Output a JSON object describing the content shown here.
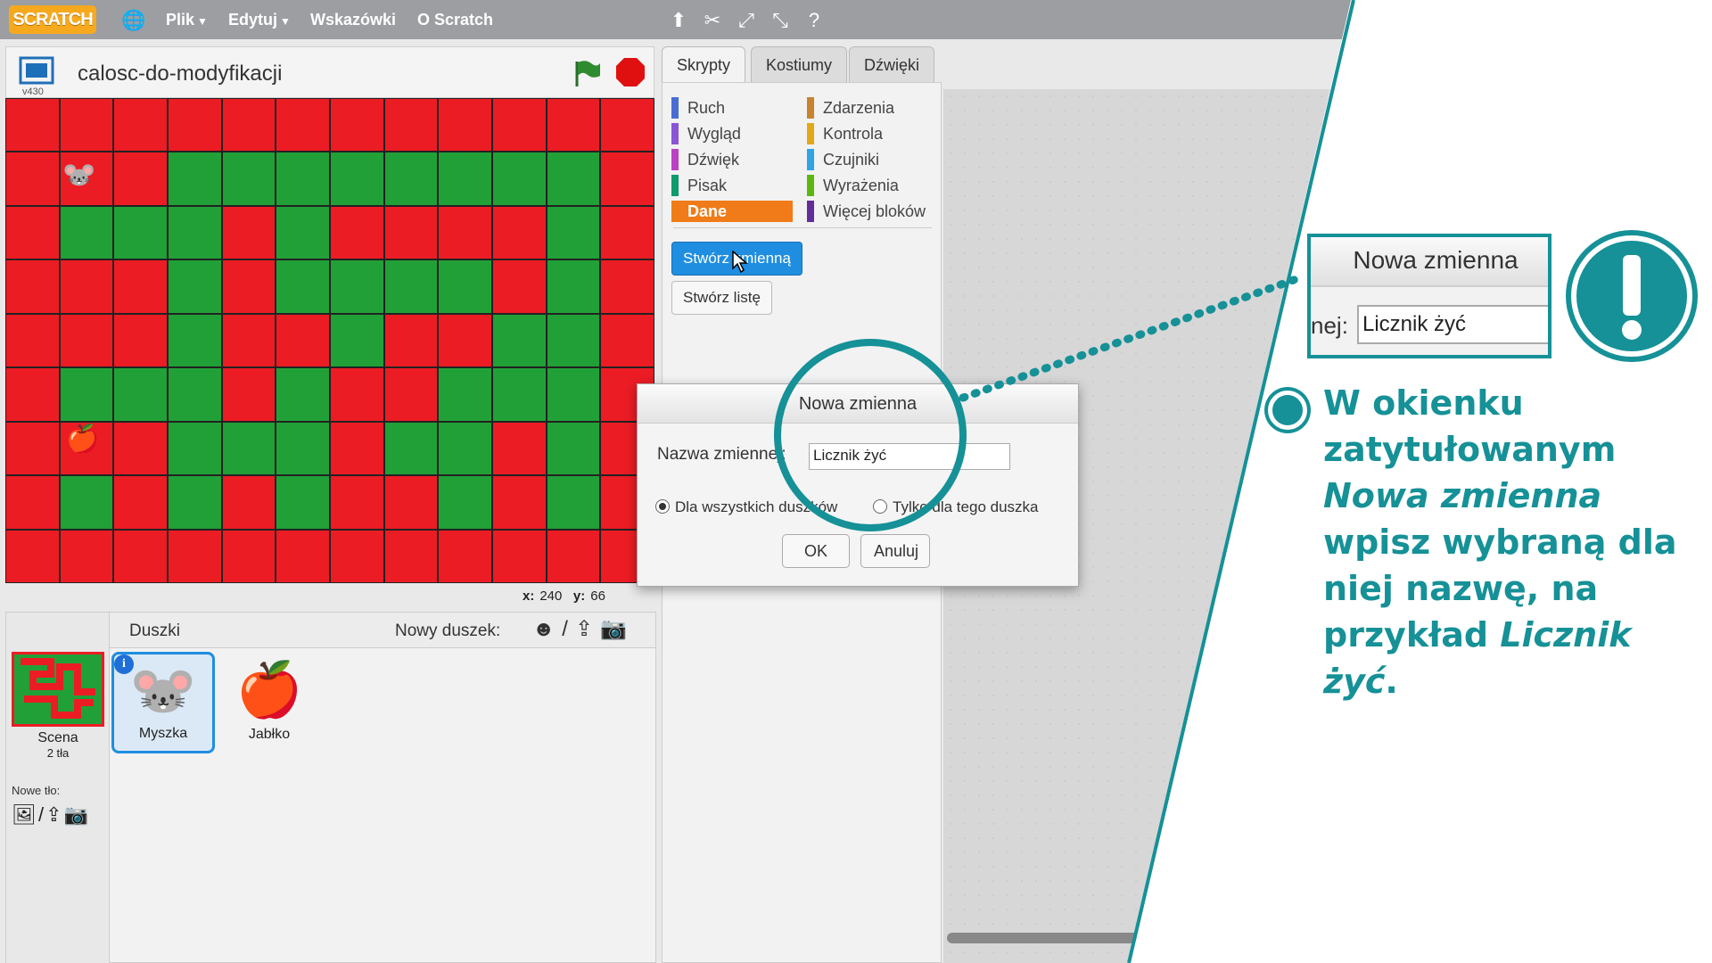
{
  "menubar": {
    "logo": "SCRATCH",
    "items": [
      {
        "label": "Plik",
        "has_menu": true
      },
      {
        "label": "Edytuj",
        "has_menu": true
      },
      {
        "label": "Wskazówki",
        "has_menu": false
      },
      {
        "label": "O Scratch",
        "has_menu": false
      }
    ],
    "tool_icons": [
      "globe-icon",
      "duplicate-icon",
      "cut-icon",
      "grow-icon",
      "shrink-icon",
      "help-icon"
    ]
  },
  "stage": {
    "project_title": "calosc-do-modyfikacji",
    "version": "v430",
    "coords": {
      "x_label": "x:",
      "x": "240",
      "y_label": "y:",
      "y": "66"
    },
    "colors": {
      "red": "#ec1c24",
      "green": "#22a038"
    }
  },
  "tabs": [
    {
      "label": "Skrypty",
      "active": true
    },
    {
      "label": "Kostiumy",
      "active": false
    },
    {
      "label": "Dźwięki",
      "active": false
    }
  ],
  "categories_left": [
    {
      "label": "Ruch",
      "color": "#4a6cd4"
    },
    {
      "label": "Wygląd",
      "color": "#8a55d7"
    },
    {
      "label": "Dźwięk",
      "color": "#bb42c3"
    },
    {
      "label": "Pisak",
      "color": "#0e9a6c"
    },
    {
      "label": "Dane",
      "color": "#ee7d16",
      "selected": true
    }
  ],
  "categories_right": [
    {
      "label": "Zdarzenia",
      "color": "#c88330"
    },
    {
      "label": "Kontrola",
      "color": "#e1a91a"
    },
    {
      "label": "Czujniki",
      "color": "#2ca5e2"
    },
    {
      "label": "Wyrażenia",
      "color": "#5cb712"
    },
    {
      "label": "Więcej bloków",
      "color": "#632d99"
    }
  ],
  "palette_buttons": {
    "make_variable": "Stwórz zmienną",
    "make_list": "Stwórz listę"
  },
  "sprites": {
    "header": "Duszki",
    "new_sprite_label": "Nowy duszek:",
    "scene": {
      "name": "Scena",
      "count": "2 tła"
    },
    "new_backdrop_label": "Nowe tło:",
    "items": [
      {
        "name": "Myszka",
        "selected": true
      },
      {
        "name": "Jabłko",
        "selected": false
      }
    ]
  },
  "dialog": {
    "title": "Nowa zmienna",
    "name_label": "Nazwa zmiennej:",
    "name_value": "Licznik żyć",
    "radio_all": "Dla wszystkich duszków",
    "radio_this": "Tylko dla tego duszka",
    "ok": "OK",
    "cancel": "Anuluj"
  },
  "zoom_inset": {
    "title": "Nowa zmienna",
    "label_fragment": "nej:",
    "value": "Licznik żyć"
  },
  "instruction": {
    "part1": "W okienku zatytułowanym ",
    "italic1": "Nowa zmienna",
    "part2": " wpisz wybraną dla niej nazwę, na przykład ",
    "italic2": "Licznik żyć",
    "part3": "."
  },
  "accent_color": "#159197"
}
